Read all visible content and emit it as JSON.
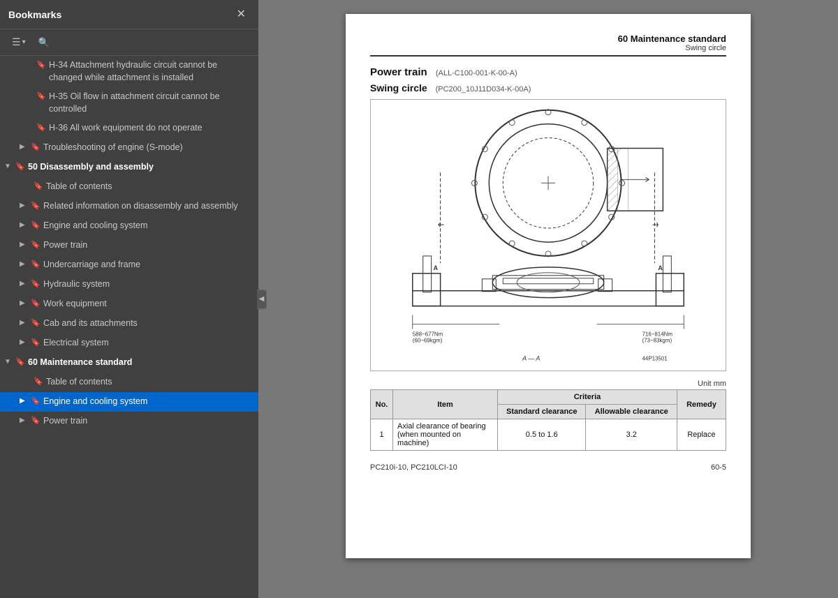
{
  "sidebar": {
    "title": "Bookmarks",
    "items": [
      {
        "id": "h34",
        "level": 2,
        "indent": 2,
        "hasChevron": false,
        "text": "H-34 Attachment hydraulic circuit cannot be changed while attachment is installed"
      },
      {
        "id": "h35",
        "level": 2,
        "indent": 2,
        "hasChevron": false,
        "text": "H-35 Oil flow in attachment circuit cannot be controlled"
      },
      {
        "id": "h36",
        "level": 2,
        "indent": 2,
        "hasChevron": false,
        "text": "H-36 All work equipment do not operate"
      },
      {
        "id": "troubleshooting",
        "level": 1,
        "indent": 1,
        "hasChevron": true,
        "chevronOpen": false,
        "text": "Troubleshooting of engine (S-mode)"
      },
      {
        "id": "section50",
        "level": 0,
        "indent": 0,
        "hasChevron": true,
        "chevronOpen": true,
        "text": "50 Disassembly and assembly"
      },
      {
        "id": "toc50",
        "level": 1,
        "indent": 1,
        "hasChevron": false,
        "text": "Table of contents"
      },
      {
        "id": "related",
        "level": 1,
        "indent": 1,
        "hasChevron": true,
        "chevronOpen": false,
        "text": "Related information on disassembly and assembly"
      },
      {
        "id": "engine-cooling-50",
        "level": 1,
        "indent": 1,
        "hasChevron": true,
        "chevronOpen": false,
        "text": "Engine and cooling system"
      },
      {
        "id": "powertrain-50",
        "level": 1,
        "indent": 1,
        "hasChevron": true,
        "chevronOpen": false,
        "text": "Power train"
      },
      {
        "id": "undercarriage-50",
        "level": 1,
        "indent": 1,
        "hasChevron": true,
        "chevronOpen": false,
        "text": "Undercarriage and frame"
      },
      {
        "id": "hydraulic-50",
        "level": 1,
        "indent": 1,
        "hasChevron": true,
        "chevronOpen": false,
        "text": "Hydraulic system"
      },
      {
        "id": "workequipment-50",
        "level": 1,
        "indent": 1,
        "hasChevron": true,
        "chevronOpen": false,
        "text": "Work equipment"
      },
      {
        "id": "cab-50",
        "level": 1,
        "indent": 1,
        "hasChevron": true,
        "chevronOpen": false,
        "text": "Cab and its attachments"
      },
      {
        "id": "electrical-50",
        "level": 1,
        "indent": 1,
        "hasChevron": true,
        "chevronOpen": false,
        "text": "Electrical system"
      },
      {
        "id": "section60",
        "level": 0,
        "indent": 0,
        "hasChevron": true,
        "chevronOpen": true,
        "text": "60 Maintenance standard"
      },
      {
        "id": "toc60",
        "level": 1,
        "indent": 1,
        "hasChevron": false,
        "text": "Table of contents"
      },
      {
        "id": "engine-cooling-60",
        "level": 1,
        "indent": 1,
        "hasChevron": true,
        "chevronOpen": false,
        "text": "Engine and cooling system",
        "active": true
      },
      {
        "id": "powertrain-60",
        "level": 1,
        "indent": 1,
        "hasChevron": true,
        "chevronOpen": false,
        "text": "Power train"
      }
    ]
  },
  "toolbar": {
    "expand_icon": "☰",
    "expand_arrow": "▾",
    "search_icon": "🔍",
    "close_icon": "✕",
    "collapse_arrow": "◀"
  },
  "document": {
    "header": {
      "title": "60 Maintenance standard",
      "subtitle": "Swing circle"
    },
    "section_heading": "Power train",
    "section_code": "(ALL-C100-001-K-00-A)",
    "subsection_heading": "Swing circle",
    "subsection_code": "(PC200_10J11D034-K-00A)",
    "unit_label": "Unit mm",
    "table": {
      "headers": [
        "No.",
        "Item",
        "Criteria",
        "",
        "Remedy"
      ],
      "subheaders": [
        "",
        "",
        "Standard clearance",
        "Allowable clearance",
        ""
      ],
      "rows": [
        {
          "no": "1",
          "item": "Axial clearance of bearing (when mounted on machine)",
          "standard": "0.5 to 1.6",
          "allowable": "3.2",
          "remedy": "Replace"
        }
      ]
    },
    "diagram": {
      "label_aa": "A — A",
      "label_torque1": "588~677Nm\n(60~69kgm)",
      "label_torque2": "716~814Nm\n(73~83kgm)",
      "label_part": "44P13501"
    },
    "footer": {
      "model": "PC210i-10, PC210LCI-10",
      "page": "60-5"
    }
  }
}
